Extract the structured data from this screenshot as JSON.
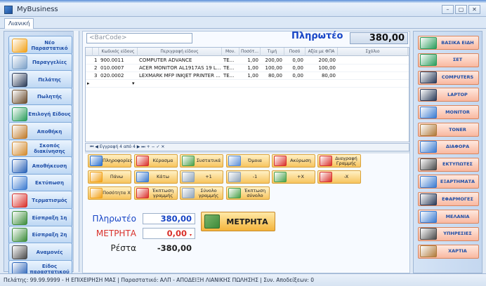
{
  "window": {
    "title": "MyBusiness",
    "tab": "Λιανική",
    "buttons": [
      "–",
      "▢",
      "✕"
    ]
  },
  "left_menu": [
    {
      "label": "Νέο Παραστατικό",
      "icon": "new-document-icon",
      "color": "#f2a21a"
    },
    {
      "label": "Παραγγελίες",
      "icon": "orders-icon",
      "color": "#7aa0c8"
    },
    {
      "label": "Πελάτης",
      "icon": "customer-icon",
      "color": "#2c3c5a"
    },
    {
      "label": "Πωλητής",
      "icon": "salesman-icon",
      "color": "#6b4d2e"
    },
    {
      "label": "Επιλογή Είδους",
      "icon": "item-select-icon",
      "color": "#2a9d5c"
    },
    {
      "label": "Αποθήκη",
      "icon": "warehouse-icon",
      "color": "#c07a2a"
    },
    {
      "label": "Σκοπός διακίνησης",
      "icon": "transport-icon",
      "color": "#d38b2f"
    },
    {
      "label": "Αποθήκευση",
      "icon": "save-icon",
      "color": "#2a63b8"
    },
    {
      "label": "Εκτύπωση",
      "icon": "print-icon",
      "color": "#3b7bd0"
    },
    {
      "label": "Τερματισμός",
      "icon": "exit-icon",
      "color": "#d9302a"
    },
    {
      "label": "Είσπραξη 1η",
      "icon": "payment1-icon",
      "color": "#3c8c3a"
    },
    {
      "label": "Είσπραξη 2η",
      "icon": "payment2-icon",
      "color": "#3c8c3a"
    },
    {
      "label": "Αναμονές",
      "icon": "waiting-icon",
      "color": "#4a4a4a"
    },
    {
      "label": "Είδος παραστατικού",
      "icon": "doc-type-icon",
      "color": "#2a63b8"
    }
  ],
  "barcode": {
    "placeholder": "<BarCode>"
  },
  "total": {
    "label": "Πληρωτέο",
    "value": "380,00"
  },
  "grid": {
    "columns": [
      "Κωδικός είδους",
      "Περιγραφή είδους",
      "Μον.",
      "Ποσότ...",
      "Τιμή",
      "Ποσό",
      "Αξία με ΦΠΑ",
      "Σχόλιο"
    ],
    "rows": [
      {
        "n": "1",
        "code": "900.0011",
        "desc": "COMPUTER ADVANCE",
        "unit": "TE...",
        "qty": "1,00",
        "price": "200,00",
        "amount": "0,00",
        "vat": "200,00",
        "comment": ""
      },
      {
        "n": "2",
        "code": "010.0007",
        "desc": "ACER MONITOR AL1917AS 19 L...",
        "unit": "TE...",
        "qty": "1,00",
        "price": "100,00",
        "amount": "0,00",
        "vat": "100,00",
        "comment": ""
      },
      {
        "n": "3",
        "code": "020.0002",
        "desc": "LEXMARK MFP INKJET PRINTER ...",
        "unit": "TE...",
        "qty": "1,00",
        "price": "80,00",
        "amount": "0,00",
        "vat": "80,00",
        "comment": ""
      }
    ],
    "record_nav": "Εγγραφή 4 από 4"
  },
  "actions": [
    {
      "label": "Πληροφορίες",
      "icon": "info-icon",
      "color": "#2a6fd0"
    },
    {
      "label": "Κέρασμα",
      "icon": "treat-icon",
      "color": "#d9302a"
    },
    {
      "label": "Συστατικά",
      "icon": "ingredients-icon",
      "color": "#4aa04a"
    },
    {
      "label": "Όμοια",
      "icon": "similar-icon",
      "color": "#5b8fd8"
    },
    {
      "label": "Ακύρωση",
      "icon": "cancel-icon",
      "color": "#d9302a"
    },
    {
      "label": "Διαγραφή Γραμμής",
      "icon": "delete-line-icon",
      "color": "#d9302a"
    },
    {
      "label": "Πάνω",
      "icon": "up-icon",
      "color": "#f2a21a"
    },
    {
      "label": "Κάτω",
      "icon": "down-icon",
      "color": "#3b7bd0"
    },
    {
      "label": "+1",
      "icon": "plus-one-icon",
      "color": "#8fa3b8"
    },
    {
      "label": "-1",
      "icon": "minus-one-icon",
      "color": "#8fa3b8"
    },
    {
      "label": "+X",
      "icon": "plus-x-icon",
      "color": "#4aa04a"
    },
    {
      "label": "-X",
      "icon": "minus-x-icon",
      "color": "#d9302a"
    },
    {
      "label": "Ποσότητα X",
      "icon": "quantity-icon",
      "color": "#f2a21a"
    },
    {
      "label": "Έκπτωση γραμμής",
      "icon": "line-discount-icon",
      "color": "#d9302a"
    },
    {
      "label": "Σύνολο γραμμής",
      "icon": "line-total-icon",
      "color": "#8fa3b8"
    },
    {
      "label": "Έκπτωση σύνολο",
      "icon": "total-discount-icon",
      "color": "#4aa04a"
    }
  ],
  "payment": {
    "due_label": "Πληρωτέο",
    "due_value": "380,00",
    "cash_label": "ΜΕΤΡΗΤΑ",
    "cash_value": "0,00",
    "rest_label": "Ρέστα",
    "rest_value": "-380,00",
    "button_label": "ΜΕΤΡΗΤΑ"
  },
  "right_menu": [
    {
      "label": "ΒΑΣΙΚΑ ΕΙΔΗ",
      "icon": "basic-items-icon",
      "color": "#2a9d5c"
    },
    {
      "label": "ΣΕΤ",
      "icon": "set-icon",
      "color": "#2a9d5c"
    },
    {
      "label": "COMPUTERS",
      "icon": "computer-icon",
      "color": "#2c3c5a"
    },
    {
      "label": "LAPTOP",
      "icon": "laptop-icon",
      "color": "#2c3c5a"
    },
    {
      "label": "MONITOR",
      "icon": "monitor-icon",
      "color": "#3b7bd0"
    },
    {
      "label": "TONER",
      "icon": "toner-icon",
      "color": "#b07a3a"
    },
    {
      "label": "ΔΙΑΦΟΡΑ",
      "icon": "misc-icon",
      "color": "#3b7bd0"
    },
    {
      "label": "ΕΚΤΥΠΩΤΕΣ",
      "icon": "printer-icon",
      "color": "#4a4a4a"
    },
    {
      "label": "ΕΞΑΡΤΗΜΑΤΑ",
      "icon": "parts-icon",
      "color": "#3b7bd0"
    },
    {
      "label": "ΕΦΑΡΜΟΓΕΣ",
      "icon": "apps-icon",
      "color": "#2c3c5a"
    },
    {
      "label": "ΜΕΛΑΝΙΑ",
      "icon": "ink-icon",
      "color": "#3b7bd0"
    },
    {
      "label": "ΥΠΗΡΕΣΙΕΣ",
      "icon": "services-icon",
      "color": "#4a4a4a"
    },
    {
      "label": "ΧΑΡΤΙΑ",
      "icon": "paper-icon",
      "color": "#b07a3a"
    }
  ],
  "statusbar": "Πελάτης: 99.99.9999 - Η ΕΠΙΧΕΙΡΗΣΗ ΜΑΣ | Παραστατικό: ΑΛΠ - ΑΠΟΔΕΙΞΗ ΛΙΑΝΙΚΗΣ ΠΩΛΗΣΗΣ | Συν. Αποδείξεων: 0"
}
